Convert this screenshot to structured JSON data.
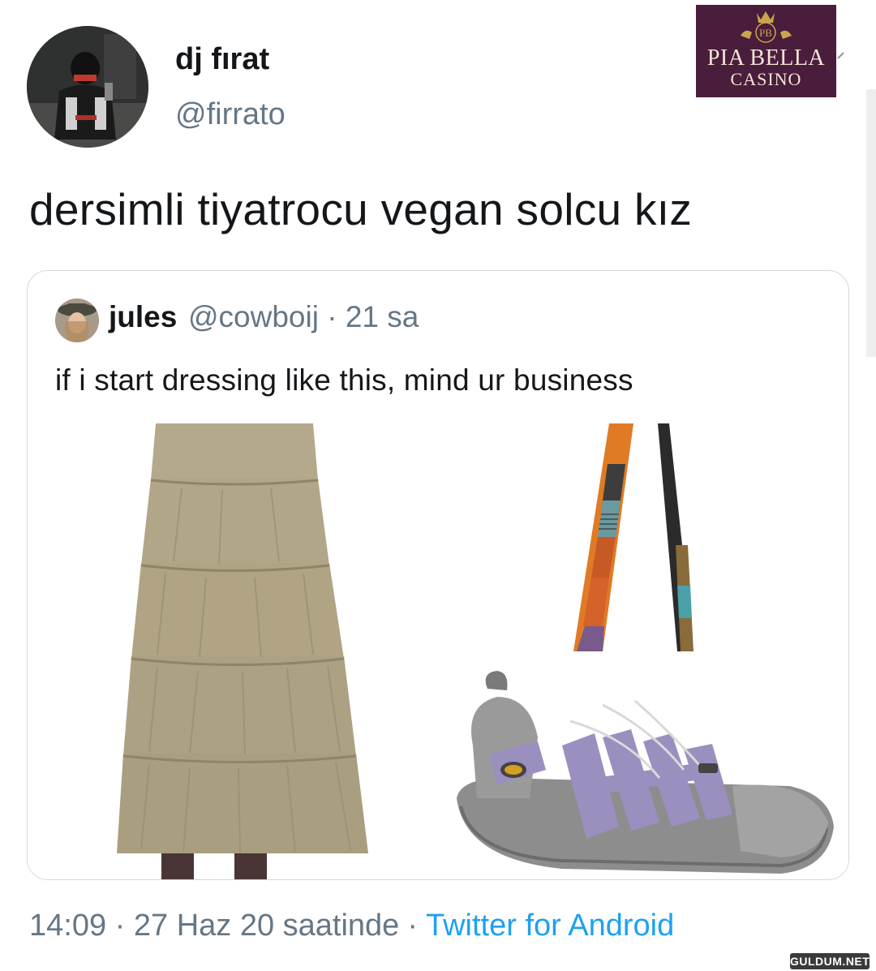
{
  "tweet": {
    "display_name": "dj fırat",
    "handle": "@firrato",
    "text": "dersimli tiyatrocu vegan solcu kız",
    "timestamp": "14:09 · 27 Haz 20 saatinde",
    "separator": "·",
    "source": "Twitter for Android"
  },
  "quoted_tweet": {
    "display_name": "jules",
    "handle": "@cowboij",
    "time": "21 sa",
    "separator": "·",
    "text": "if i start dressing like this, mind ur business",
    "images": [
      "tiered-khaki-maxi-skirt",
      "patchwork-bag-strap",
      "purple-grey-hiking-sandal"
    ]
  },
  "ad_overlay": {
    "brand_monogram": "PB",
    "title": "PIA BELLA",
    "subtitle": "CASINO",
    "colors": {
      "background": "#4a1d3d",
      "text": "#f2e7d2",
      "crown": "#c9a64b"
    }
  },
  "watermark": "GULDUM.NET",
  "colors": {
    "link": "#1da1f2",
    "secondary_text": "#657786",
    "primary_text": "#14171a",
    "border": "#cfd9de"
  }
}
